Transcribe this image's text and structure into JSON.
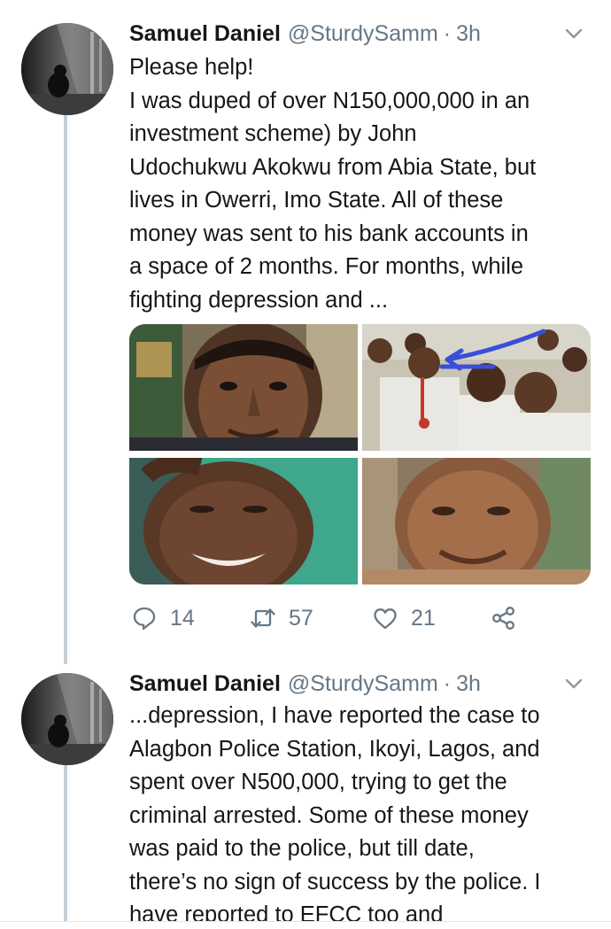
{
  "tweets": [
    {
      "author_name": "Samuel Daniel",
      "handle": "@SturdySamm",
      "separator": "·",
      "time": "3h",
      "lines": [
        "Please help!",
        "I was duped of over N150,000,000 in an",
        "investment scheme) by John",
        "Udochukwu Akokwu from Abia State, but",
        "lives in Owerri, Imo State. All of these",
        "money was sent to his bank accounts in",
        "a space of 2 months. For months, while",
        "fighting depression and ..."
      ],
      "reply_count": "14",
      "retweet_count": "57",
      "like_count": "21"
    },
    {
      "author_name": "Samuel Daniel",
      "handle": "@SturdySamm",
      "separator": "·",
      "time": "3h",
      "lines": [
        "...depression, I have reported the case to",
        "Alagbon Police Station, Ikoyi, Lagos, and",
        "spent over N500,000, trying to get the",
        "criminal arrested. Some of these money",
        "was paid to the police, but till date,",
        "there’s no sign of success by the police. I",
        "have reported to EFCC too and"
      ]
    }
  ],
  "icons": {
    "reply": "speech-bubble-icon",
    "retweet": "retweet-arrows-icon",
    "like": "heart-icon",
    "share": "share-nodes-icon",
    "menu": "chevron-down-icon"
  },
  "colors": {
    "text": "#14171a",
    "secondary": "#657786",
    "thread_line": "#c4cfd6",
    "annotation_arrow": "#3a4fd8"
  }
}
